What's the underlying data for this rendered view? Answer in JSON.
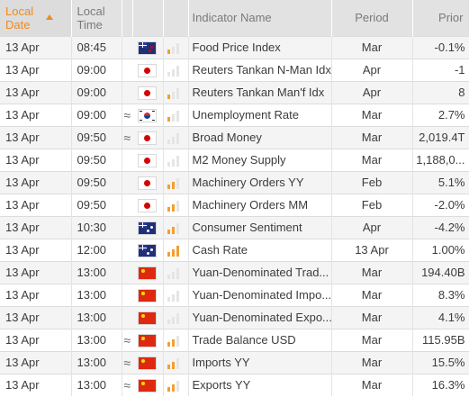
{
  "header": {
    "local_date": "Local Date",
    "local_time": "Local Time",
    "indicator_name": "Indicator Name",
    "period": "Period",
    "prior": "Prior"
  },
  "colors": {
    "accent": "#ef8a1c",
    "importance_bar": "#f0a030",
    "header_bg": "#e2e2e2"
  },
  "rows": [
    {
      "date": "13 Apr",
      "time": "08:45",
      "vol": "",
      "flag": "nz-flag-icon",
      "importance": 1,
      "name": "Food Price Index",
      "period": "Mar",
      "prior": "-0.1%"
    },
    {
      "date": "13 Apr",
      "time": "09:00",
      "vol": "",
      "flag": "jp-flag-icon",
      "importance": 0,
      "name": "Reuters Tankan N-Man Idx",
      "period": "Apr",
      "prior": "-1"
    },
    {
      "date": "13 Apr",
      "time": "09:00",
      "vol": "",
      "flag": "jp-flag-icon",
      "importance": 1,
      "name": "Reuters Tankan Man'f Idx",
      "period": "Apr",
      "prior": "8"
    },
    {
      "date": "13 Apr",
      "time": "09:00",
      "vol": "≈",
      "flag": "kr-flag-icon",
      "importance": 1,
      "name": "Unemployment Rate",
      "period": "Mar",
      "prior": "2.7%"
    },
    {
      "date": "13 Apr",
      "time": "09:50",
      "vol": "≈",
      "flag": "jp-flag-icon",
      "importance": 0,
      "name": "Broad Money",
      "period": "Mar",
      "prior": "2,019.4T"
    },
    {
      "date": "13 Apr",
      "time": "09:50",
      "vol": "",
      "flag": "jp-flag-icon",
      "importance": 0,
      "name": "M2 Money Supply",
      "period": "Mar",
      "prior": "1,188,0..."
    },
    {
      "date": "13 Apr",
      "time": "09:50",
      "vol": "",
      "flag": "jp-flag-icon",
      "importance": 2,
      "name": "Machinery Orders YY",
      "period": "Feb",
      "prior": "5.1%"
    },
    {
      "date": "13 Apr",
      "time": "09:50",
      "vol": "",
      "flag": "jp-flag-icon",
      "importance": 2,
      "name": "Machinery Orders MM",
      "period": "Feb",
      "prior": "-2.0%"
    },
    {
      "date": "13 Apr",
      "time": "10:30",
      "vol": "",
      "flag": "au-flag-icon",
      "importance": 2,
      "name": "Consumer Sentiment",
      "period": "Apr",
      "prior": "-4.2%"
    },
    {
      "date": "13 Apr",
      "time": "12:00",
      "vol": "",
      "flag": "au-flag-icon",
      "importance": 3,
      "name": "Cash Rate",
      "period": "13 Apr",
      "prior": "1.00%"
    },
    {
      "date": "13 Apr",
      "time": "13:00",
      "vol": "",
      "flag": "cn-flag-icon",
      "importance": 0,
      "name": "Yuan-Denominated Trad...",
      "period": "Mar",
      "prior": "194.40B"
    },
    {
      "date": "13 Apr",
      "time": "13:00",
      "vol": "",
      "flag": "cn-flag-icon",
      "importance": 0,
      "name": "Yuan-Denominated Impo...",
      "period": "Mar",
      "prior": "8.3%"
    },
    {
      "date": "13 Apr",
      "time": "13:00",
      "vol": "",
      "flag": "cn-flag-icon",
      "importance": 0,
      "name": "Yuan-Denominated Expo...",
      "period": "Mar",
      "prior": "4.1%"
    },
    {
      "date": "13 Apr",
      "time": "13:00",
      "vol": "≈",
      "flag": "cn-flag-icon",
      "importance": 2,
      "name": "Trade Balance USD",
      "period": "Mar",
      "prior": "115.95B"
    },
    {
      "date": "13 Apr",
      "time": "13:00",
      "vol": "≈",
      "flag": "cn-flag-icon",
      "importance": 2,
      "name": "Imports YY",
      "period": "Mar",
      "prior": "15.5%"
    },
    {
      "date": "13 Apr",
      "time": "13:00",
      "vol": "≈",
      "flag": "cn-flag-icon",
      "importance": 2,
      "name": "Exports YY",
      "period": "Mar",
      "prior": "16.3%"
    }
  ]
}
